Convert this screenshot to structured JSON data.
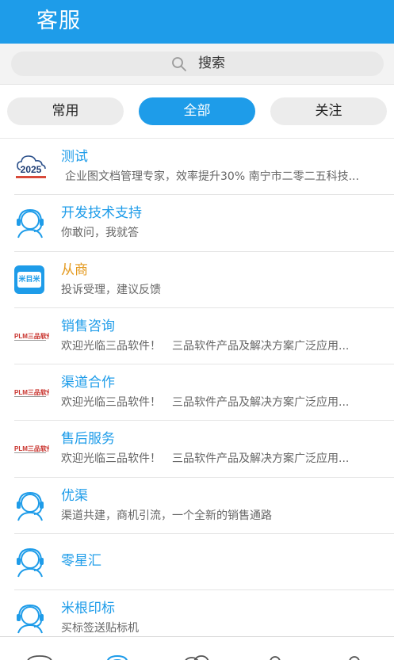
{
  "header": {
    "title": "客服"
  },
  "search": {
    "label": "搜索",
    "icon": "search-icon"
  },
  "tabs": [
    {
      "label": "常用",
      "active": false
    },
    {
      "label": "全部",
      "active": true
    },
    {
      "label": "关注",
      "active": false
    }
  ],
  "colors": {
    "accent": "#1e9ce9",
    "orange": "#e49a1f",
    "text_secondary": "#666666"
  },
  "services": [
    {
      "name": "测试",
      "desc": "企业图文档管理专家，效率提升30% 南宁市二零二五科技...",
      "avatar": "logo-2025",
      "logo_text": "2025"
    },
    {
      "name": "开发技术支持",
      "desc": "你敢问，我就答",
      "avatar": "headset-icon"
    },
    {
      "name": "从商",
      "desc": "投诉受理，建议反馈",
      "avatar": "logo-mimi",
      "logo_text": "米目米"
    },
    {
      "name": "销售咨询",
      "desc": "欢迎光临三品软件！　三品软件产品及解决方案广泛应用...",
      "avatar": "logo-plm",
      "logo_text": "PLM三品软件"
    },
    {
      "name": "渠道合作",
      "desc": "欢迎光临三品软件！　三品软件产品及解决方案广泛应用...",
      "avatar": "logo-plm",
      "logo_text": "PLM三品软件"
    },
    {
      "name": "售后服务",
      "desc": "欢迎光临三品软件！　三品软件产品及解决方案广泛应用...",
      "avatar": "logo-plm",
      "logo_text": "PLM三品软件"
    },
    {
      "name": "优渠",
      "desc": "渠道共建，商机引流，一个全新的销售通路",
      "avatar": "headset-icon"
    },
    {
      "name": "零星汇",
      "desc": "",
      "avatar": "headset-icon"
    },
    {
      "name": "米根印标",
      "desc": "买标签送贴标机",
      "avatar": "headset-icon"
    }
  ]
}
